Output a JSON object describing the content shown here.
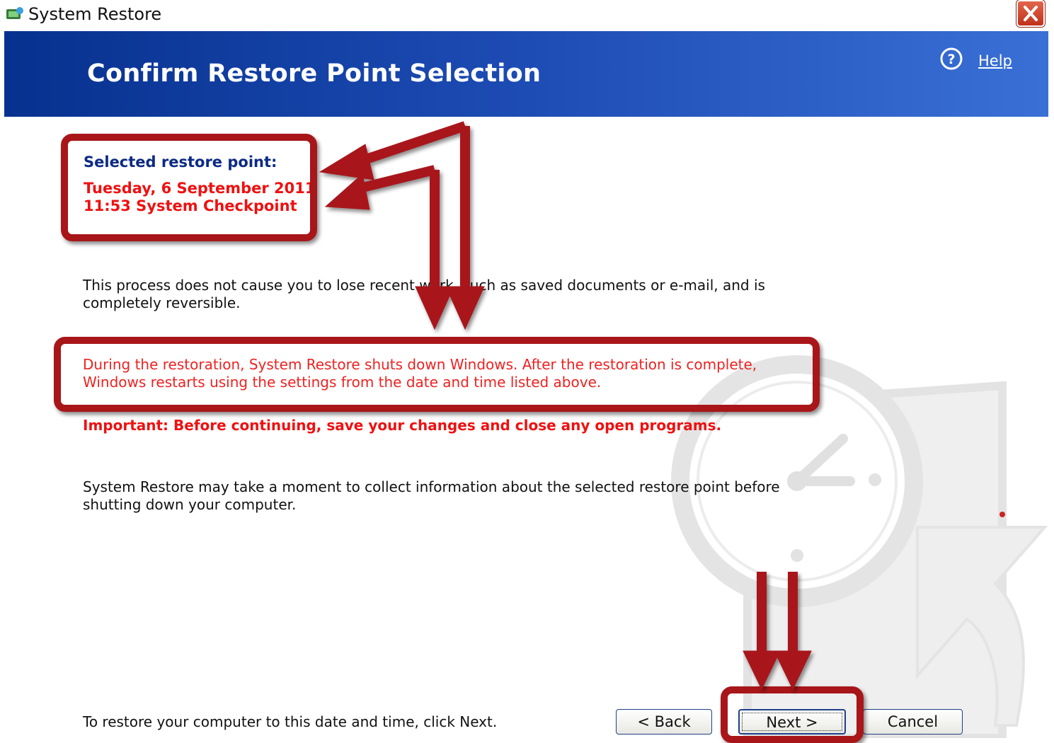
{
  "window": {
    "title": "System Restore"
  },
  "header": {
    "heading": "Confirm Restore Point Selection",
    "help_label": "Help"
  },
  "selection": {
    "label": "Selected restore point:",
    "date": "Tuesday, 6 September 2011",
    "description": "11:53 System Checkpoint"
  },
  "body": {
    "paragraph1": "This process does not cause you to lose recent work, such as saved documents or e-mail, and is completely reversible.",
    "paragraph2": "During the restoration, System Restore shuts down Windows. After the restoration is complete, Windows restarts using the settings from the date and time listed above.",
    "important": "Important: Before continuing, save your changes and close any open programs.",
    "paragraph3": "System Restore may take a moment to collect information about the selected restore point before shutting down your computer.",
    "footer_hint": "To restore your computer to this date and time, click Next."
  },
  "buttons": {
    "back": "< Back",
    "next": "Next >",
    "cancel": "Cancel"
  },
  "colors": {
    "header_blue": "#07318f",
    "highlight_red": "#ee1111",
    "annotation_red": "#a8161a"
  },
  "icons": [
    "system-restore-app-icon",
    "close-icon",
    "help-icon",
    "clock-watermark-icon"
  ]
}
